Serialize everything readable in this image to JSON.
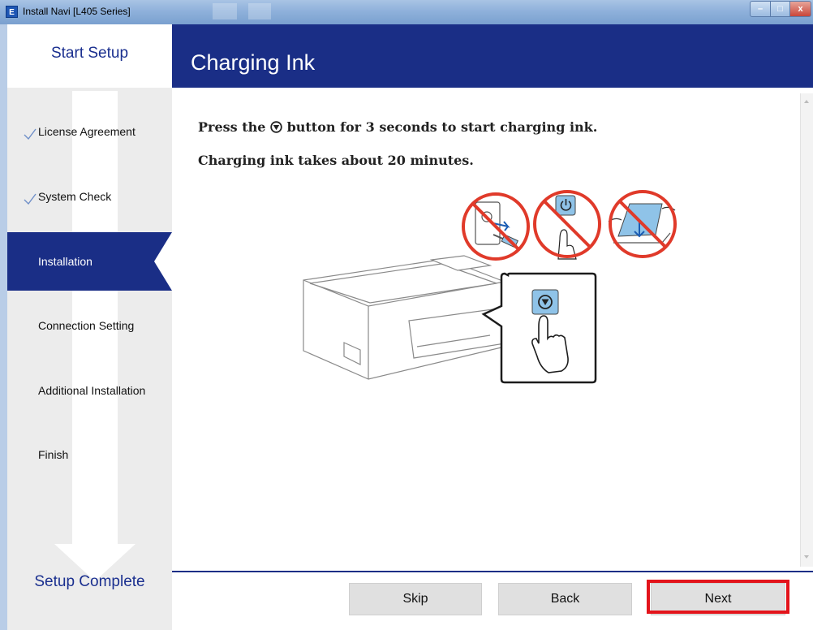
{
  "window": {
    "title": "Install Navi [L405 Series]",
    "icon_letter": "E",
    "minimize_label": "–",
    "maximize_label": "□",
    "close_label": "x"
  },
  "sidebar": {
    "header": "Start Setup",
    "footer": "Setup Complete",
    "steps": [
      {
        "label": "License Agreement",
        "state": "done"
      },
      {
        "label": "System Check",
        "state": "done"
      },
      {
        "label": "Installation",
        "state": "current"
      },
      {
        "label": "Connection Setting",
        "state": "pending"
      },
      {
        "label": "Additional Installation",
        "state": "pending"
      },
      {
        "label": "Finish",
        "state": "pending"
      }
    ]
  },
  "page": {
    "title": "Charging Ink",
    "instruction_pre": "Press the",
    "instruction_post": "button for 3 seconds to start charging ink.",
    "instruction_2": "Charging ink takes about 20 minutes."
  },
  "buttons": {
    "skip": "Skip",
    "back": "Back",
    "next": "Next"
  },
  "colors": {
    "navy": "#1a2e86",
    "highlight": "#e3141b",
    "prohibited": "#e03a2a",
    "button_blue": "#8fc3e8"
  }
}
